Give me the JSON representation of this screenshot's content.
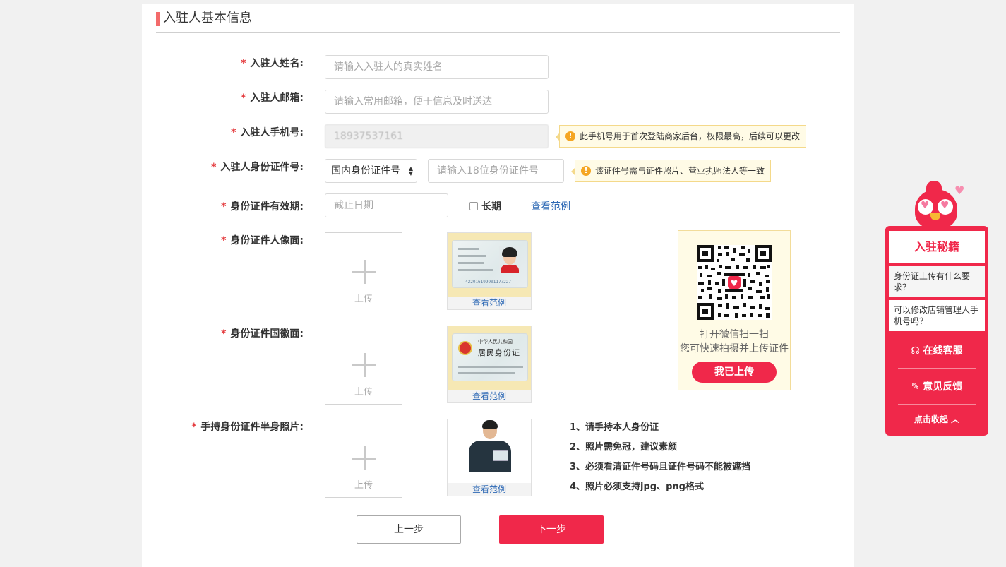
{
  "section": {
    "title": "入驻人基本信息"
  },
  "form": {
    "star": "*",
    "name": {
      "label": "入驻人姓名:",
      "placeholder": "请输入入驻人的真实姓名"
    },
    "email": {
      "label": "入驻人邮箱:",
      "placeholder": "请输入常用邮箱，便于信息及时送达"
    },
    "phone": {
      "label": "入驻人手机号:",
      "value": "18937537161",
      "tip": "此手机号用于首次登陆商家后台，权限最高，后续可以更改"
    },
    "id_number": {
      "label": "入驻人身份证件号:",
      "select_value": "国内身份证件号",
      "placeholder": "请输入18位身份证件号",
      "tip": "该证件号需与证件照片、营业执照法人等一致"
    },
    "validity": {
      "label": "身份证件有效期:",
      "placeholder": "截止日期",
      "long_term": "长期",
      "example_link": "查看范例"
    },
    "portrait_side": {
      "label": "身份证件人像面:",
      "upload_text": "上传",
      "sample_caption": "查看范例"
    },
    "emblem_side": {
      "label": "身份证件国徽面:",
      "upload_text": "上传",
      "sample_caption": "查看范例"
    },
    "handheld": {
      "label": "手持身份证件半身照片:",
      "upload_text": "上传",
      "sample_caption": "查看范例"
    }
  },
  "samples": {
    "portrait_number": "422016199901177227",
    "emblem_line1": "中华人民共和国",
    "emblem_line2": "居民身份证"
  },
  "qr": {
    "line1": "打开微信扫一扫",
    "line2": "您可快速拍摄并上传证件",
    "button": "我已上传"
  },
  "requirements": [
    "1、请手持本人身份证",
    "2、照片需免冠，建议素颜",
    "3、必须看清证件号码且证件号码不能被遮挡",
    "4、照片必须支持jpg、png格式"
  ],
  "buttons": {
    "prev": "上一步",
    "next": "下一步"
  },
  "widget": {
    "title": "入驻秘籍",
    "q1": "身份证上传有什么要求？",
    "q2": "可以修改店铺管理人手机号吗？",
    "online_service": "在线客服",
    "feedback": "意见反馈",
    "collapse": "点击收起"
  },
  "colors": {
    "accent": "#f0284a",
    "link": "#2f6ab5",
    "tip_bg": "#fffbe6"
  }
}
